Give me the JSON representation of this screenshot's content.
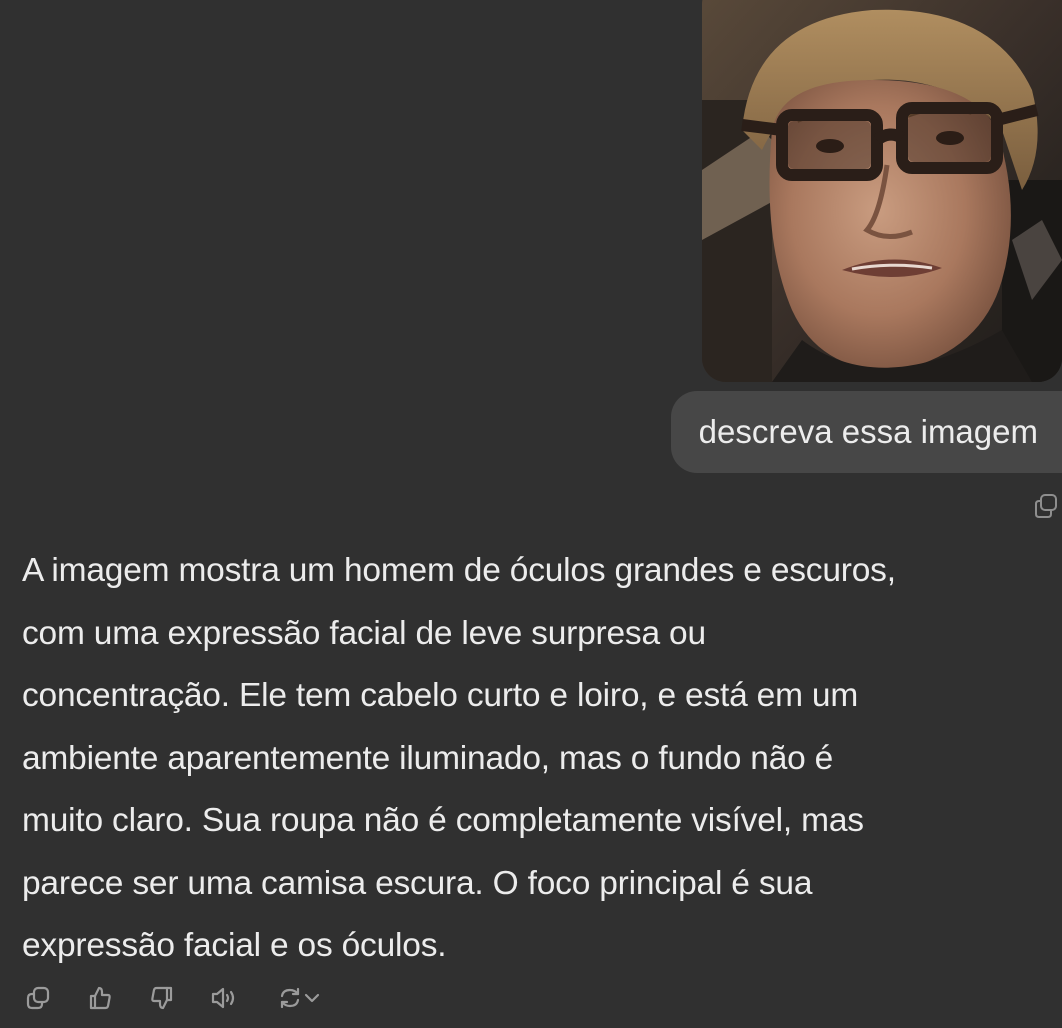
{
  "user_message": {
    "image_alt": "Homem de óculos grandes e escuros",
    "text": "descreva essa imagem"
  },
  "assistant_message": {
    "lines": [
      "A imagem mostra um homem de óculos grandes e escuros,",
      "com uma expressão facial de leve surpresa ou",
      "concentração. Ele tem cabelo curto e loiro, e está em um",
      "ambiente aparentemente iluminado, mas o fundo não é",
      "muito claro. Sua roupa não é completamente visível, mas",
      "parece ser uma camisa escura. O foco principal é sua",
      "expressão facial e os óculos."
    ]
  },
  "toolbar": {
    "icons": [
      "copy-icon",
      "thumbs-up-icon",
      "thumbs-down-icon",
      "read-aloud-icon",
      "regenerate-icon",
      "chevron-down-icon"
    ]
  },
  "colors": {
    "background": "#303030",
    "user_bubble": "#474747",
    "text": "#ececec",
    "icon": "#9b9b9b"
  }
}
